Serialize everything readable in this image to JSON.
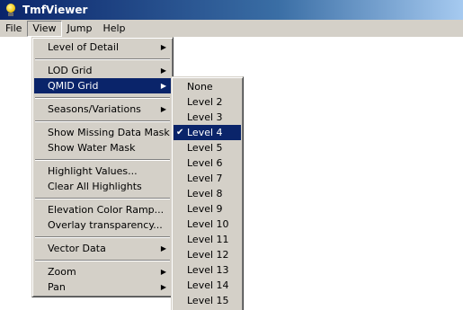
{
  "window": {
    "title": "TmfViewer"
  },
  "menubar": {
    "items": [
      {
        "label": "File"
      },
      {
        "label": "View"
      },
      {
        "label": "Jump"
      },
      {
        "label": "Help"
      }
    ]
  },
  "view_menu": {
    "level_of_detail": "Level of Detail",
    "lod_grid": "LOD Grid",
    "qmid_grid": "QMID Grid",
    "seasons_variations": "Seasons/Variations",
    "show_missing_data_mask": "Show Missing Data Mask",
    "show_water_mask": "Show Water Mask",
    "highlight_values": "Highlight Values...",
    "clear_all_highlights": "Clear All Highlights",
    "elevation_color_ramp": "Elevation Color Ramp...",
    "overlay_transparency": "Overlay transparency...",
    "vector_data": "Vector Data",
    "zoom": "Zoom",
    "pan": "Pan"
  },
  "qmid_menu": {
    "items": [
      {
        "label": "None"
      },
      {
        "label": "Level 2"
      },
      {
        "label": "Level 3"
      },
      {
        "label": "Level 4",
        "checked": true
      },
      {
        "label": "Level 5"
      },
      {
        "label": "Level 6"
      },
      {
        "label": "Level 7"
      },
      {
        "label": "Level 8"
      },
      {
        "label": "Level 9"
      },
      {
        "label": "Level 10"
      },
      {
        "label": "Level 11"
      },
      {
        "label": "Level 12"
      },
      {
        "label": "Level 13"
      },
      {
        "label": "Level 14"
      },
      {
        "label": "Level 15"
      }
    ]
  },
  "colors": {
    "highlight": "#0a246a",
    "menu_background": "#d4d0c8"
  }
}
